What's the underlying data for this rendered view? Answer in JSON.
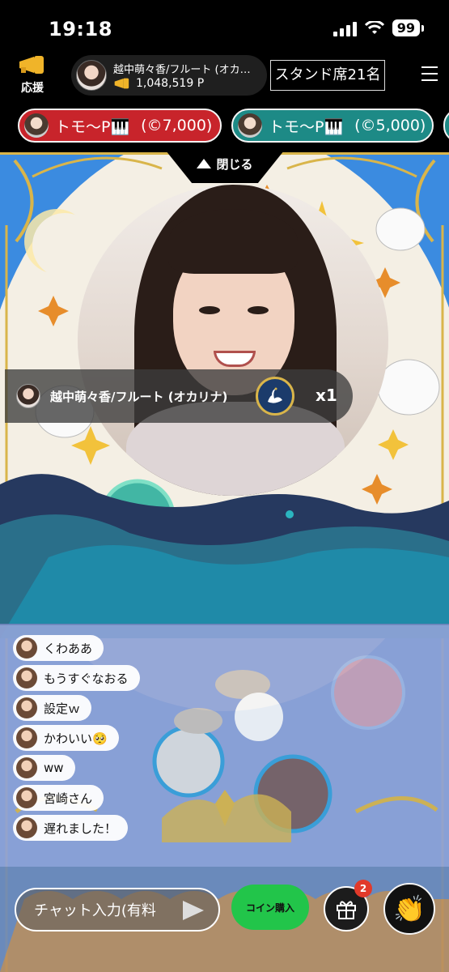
{
  "status": {
    "time": "19:18",
    "battery": "99"
  },
  "header": {
    "cheer_label": "応援",
    "performer_name": "越中萌々香/フルート (オカ…",
    "points": "1,048,519 P",
    "stand_label": "スタンド席21名"
  },
  "ranking": [
    {
      "name": "トモ〜P🎹",
      "amount": "(©7,000)",
      "color": "#c8242b"
    },
    {
      "name": "トモ〜P🎹",
      "amount": "(©5,000)",
      "color": "#1d8a86"
    }
  ],
  "stage": {
    "close_label": "閉じる",
    "performer_name": "越中萌々香/フルート (オカリナ)",
    "multiplier": "x1"
  },
  "chat": [
    {
      "text": "くわああ"
    },
    {
      "text": "もうすぐなおる"
    },
    {
      "text": "設定ｗ"
    },
    {
      "text": "かわいい🥺"
    },
    {
      "text": "ww"
    },
    {
      "text": "宮崎さん"
    },
    {
      "text": "遅れました！"
    }
  ],
  "bottom": {
    "chat_placeholder": "チャット入力(有料",
    "coin_label": "コイン購入",
    "gift_count": "2",
    "clap_emoji": "👏"
  },
  "colors": {
    "accent_gold": "#d9b54a",
    "coin_green": "#22c54a",
    "rank_red": "#c8242b",
    "rank_teal": "#1d8a86"
  }
}
